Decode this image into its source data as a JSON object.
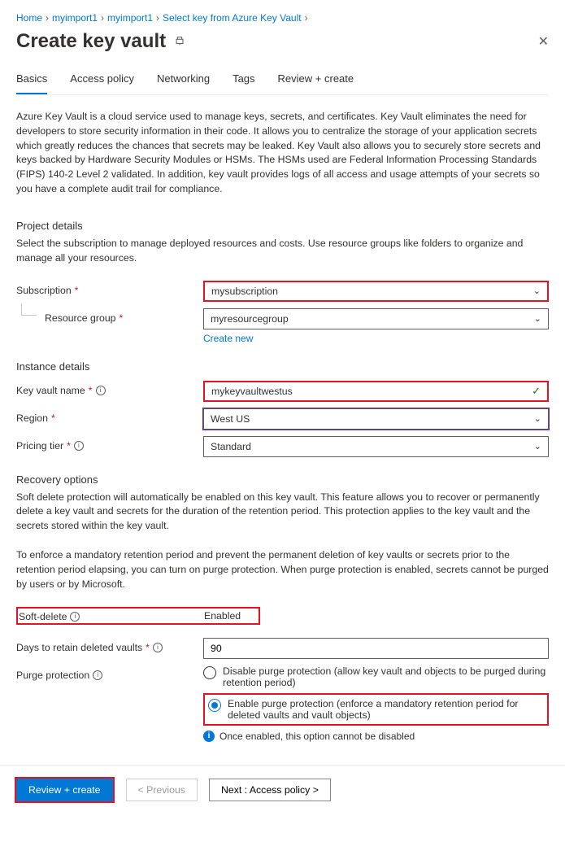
{
  "breadcrumb": {
    "items": [
      "Home",
      "myimport1",
      "myimport1",
      "Select key from Azure Key Vault"
    ]
  },
  "header": {
    "title": "Create key vault"
  },
  "tabs": {
    "items": [
      "Basics",
      "Access policy",
      "Networking",
      "Tags",
      "Review + create"
    ],
    "active": 0
  },
  "intro": "Azure Key Vault is a cloud service used to manage keys, secrets, and certificates. Key Vault eliminates the need for developers to store security information in their code. It allows you to centralize the storage of your application secrets which greatly reduces the chances that secrets may be leaked. Key Vault also allows you to securely store secrets and keys backed by Hardware Security Modules or HSMs. The HSMs used are Federal Information Processing Standards (FIPS) 140-2 Level 2 validated. In addition, key vault provides logs of all access and usage attempts of your secrets so you have a complete audit trail for compliance.",
  "project": {
    "heading": "Project details",
    "sub": "Select the subscription to manage deployed resources and costs. Use resource groups like folders to organize and manage all your resources.",
    "subscription_label": "Subscription",
    "subscription_value": "mysubscription",
    "resource_group_label": "Resource group",
    "resource_group_value": "myresourcegroup",
    "create_new": "Create new"
  },
  "instance": {
    "heading": "Instance details",
    "name_label": "Key vault name",
    "name_value": "mykeyvaultwestus",
    "region_label": "Region",
    "region_value": "West US",
    "tier_label": "Pricing tier",
    "tier_value": "Standard"
  },
  "recovery": {
    "heading": "Recovery options",
    "p1": "Soft delete protection will automatically be enabled on this key vault. This feature allows you to recover or permanently delete a key vault and secrets for the duration of the retention period. This protection applies to the key vault and the secrets stored within the key vault.",
    "p2": "To enforce a mandatory retention period and prevent the permanent deletion of key vaults or secrets prior to the retention period elapsing, you can turn on purge protection. When purge protection is enabled, secrets cannot be purged by users or by Microsoft.",
    "soft_delete_label": "Soft-delete",
    "soft_delete_value": "Enabled",
    "retain_label": "Days to retain deleted vaults",
    "retain_value": "90",
    "purge_label": "Purge protection",
    "purge_opt_disable": "Disable purge protection (allow key vault and objects to be purged during retention period)",
    "purge_opt_enable": "Enable purge protection (enforce a mandatory retention period for deleted vaults and vault objects)",
    "purge_info": "Once enabled, this option cannot be disabled"
  },
  "footer": {
    "review": "Review + create",
    "previous": "< Previous",
    "next": "Next : Access policy >"
  }
}
